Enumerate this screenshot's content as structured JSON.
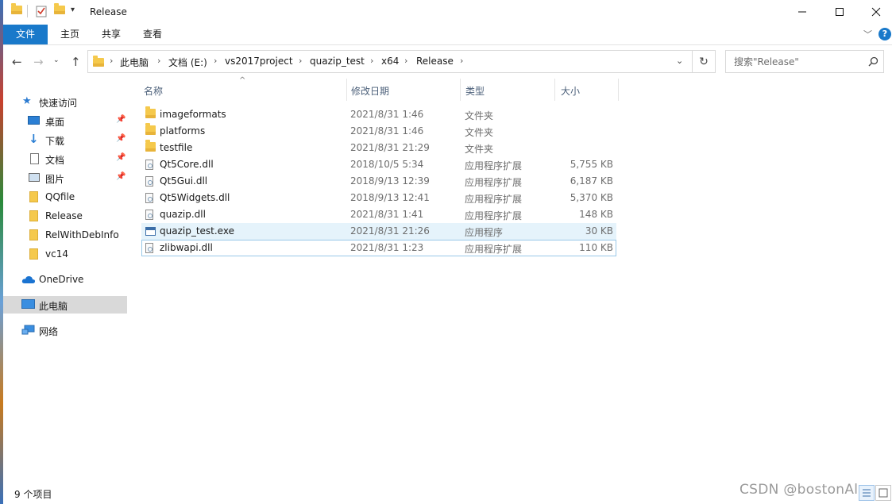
{
  "window": {
    "title": "Release"
  },
  "ribbon": {
    "tabs": [
      "文件",
      "主页",
      "共享",
      "查看"
    ]
  },
  "address": {
    "crumbs": [
      "此电脑",
      "文档 (E:)",
      "vs2017project",
      "quazip_test",
      "x64",
      "Release"
    ]
  },
  "search": {
    "placeholder": "搜索\"Release\""
  },
  "nav": {
    "quick_access": "快速访问",
    "items": [
      {
        "label": "桌面",
        "icon": "desktop-icon",
        "pinned": true
      },
      {
        "label": "下载",
        "icon": "download-icon",
        "pinned": true
      },
      {
        "label": "文档",
        "icon": "document-icon",
        "pinned": true
      },
      {
        "label": "图片",
        "icon": "pictures-icon",
        "pinned": true
      },
      {
        "label": "QQfile",
        "icon": "folder-icon",
        "pinned": false
      },
      {
        "label": "Release",
        "icon": "folder-icon",
        "pinned": false
      },
      {
        "label": "RelWithDebInfo",
        "icon": "folder-icon",
        "pinned": false
      },
      {
        "label": "vc14",
        "icon": "folder-icon",
        "pinned": false
      }
    ],
    "onedrive": "OneDrive",
    "this_pc": "此电脑",
    "network": "网络"
  },
  "columns": {
    "name": "名称",
    "date": "修改日期",
    "type": "类型",
    "size": "大小"
  },
  "files": [
    {
      "name": "imageformats",
      "date": "2021/8/31 1:46",
      "type": "文件夹",
      "size": "",
      "icon": "folder-icon"
    },
    {
      "name": "platforms",
      "date": "2021/8/31 1:46",
      "type": "文件夹",
      "size": "",
      "icon": "folder-icon"
    },
    {
      "name": "testfile",
      "date": "2021/8/31 21:29",
      "type": "文件夹",
      "size": "",
      "icon": "folder-icon"
    },
    {
      "name": "Qt5Core.dll",
      "date": "2018/10/5 5:34",
      "type": "应用程序扩展",
      "size": "5,755 KB",
      "icon": "dll-file-icon"
    },
    {
      "name": "Qt5Gui.dll",
      "date": "2018/9/13 12:39",
      "type": "应用程序扩展",
      "size": "6,187 KB",
      "icon": "dll-file-icon"
    },
    {
      "name": "Qt5Widgets.dll",
      "date": "2018/9/13 12:41",
      "type": "应用程序扩展",
      "size": "5,370 KB",
      "icon": "dll-file-icon"
    },
    {
      "name": "quazip.dll",
      "date": "2021/8/31 1:41",
      "type": "应用程序扩展",
      "size": "148 KB",
      "icon": "dll-file-icon"
    },
    {
      "name": "quazip_test.exe",
      "date": "2021/8/31 21:26",
      "type": "应用程序",
      "size": "30 KB",
      "icon": "exe-file-icon"
    },
    {
      "name": "zlibwapi.dll",
      "date": "2021/8/31 1:23",
      "type": "应用程序扩展",
      "size": "110 KB",
      "icon": "dll-file-icon"
    }
  ],
  "status": {
    "item_count": "9 个项目"
  },
  "watermark": "CSDN @bostonAl"
}
